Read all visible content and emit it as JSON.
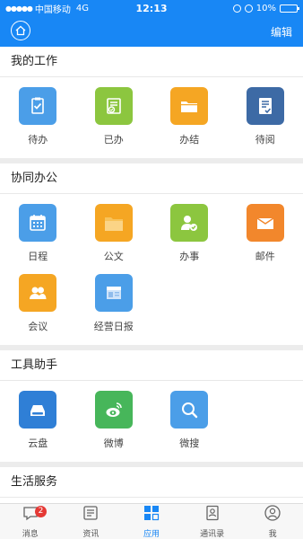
{
  "status_bar": {
    "signal": "●●●●●",
    "carrier": "中国移动",
    "network": "4G",
    "time": "12:13",
    "battery": "10%",
    "battery_level": 0.1
  },
  "nav": {
    "home_icon": "home-icon",
    "edit_label": "编辑"
  },
  "sections": [
    {
      "title": "我的工作",
      "items": [
        {
          "label": "待办",
          "icon": "clipboard-check-icon",
          "color": "#4b9ee8"
        },
        {
          "label": "已办",
          "icon": "done-list-icon",
          "color": "#8cc63f"
        },
        {
          "label": "办结",
          "icon": "folder-icon",
          "color": "#f5a623"
        },
        {
          "label": "待阅",
          "icon": "document-check-icon",
          "color": "#3d6aa5"
        }
      ]
    },
    {
      "title": "协同办公",
      "items": [
        {
          "label": "日程",
          "icon": "calendar-icon",
          "color": "#4b9ee8"
        },
        {
          "label": "公文",
          "icon": "open-folder-icon",
          "color": "#f5a623"
        },
        {
          "label": "办事",
          "icon": "user-check-icon",
          "color": "#8cc63f"
        },
        {
          "label": "邮件",
          "icon": "envelope-icon",
          "color": "#f2872c"
        },
        {
          "label": "会议",
          "icon": "group-icon",
          "color": "#f5a623"
        },
        {
          "label": "经营日报",
          "icon": "newspaper-icon",
          "color": "#4b9ee8"
        }
      ]
    },
    {
      "title": "工具助手",
      "items": [
        {
          "label": "云盘",
          "icon": "cloud-drive-icon",
          "color": "#2f7fd6"
        },
        {
          "label": "微博",
          "icon": "weibo-icon",
          "color": "#47b65a"
        },
        {
          "label": "微搜",
          "icon": "search-icon",
          "color": "#4b9ee8"
        }
      ]
    },
    {
      "title": "生活服务",
      "items": [
        {
          "label": "",
          "icon": "service-icon-1",
          "color": "#2f8fe0"
        },
        {
          "label": "",
          "icon": "service-icon-2",
          "color": "#5aa7e8"
        },
        {
          "label": "",
          "icon": "service-icon-3",
          "color": "#2f8fe0"
        },
        {
          "label": "",
          "icon": "service-icon-4",
          "color": "#f5a623"
        }
      ]
    }
  ],
  "tabs": [
    {
      "label": "消息",
      "icon": "chat-icon",
      "badge": "2"
    },
    {
      "label": "资讯",
      "icon": "news-icon"
    },
    {
      "label": "应用",
      "icon": "apps-grid-icon",
      "active": true
    },
    {
      "label": "通讯录",
      "icon": "contacts-icon"
    },
    {
      "label": "我",
      "icon": "profile-icon"
    }
  ],
  "colors": {
    "brand": "#1887f5",
    "badge": "#e53935"
  }
}
